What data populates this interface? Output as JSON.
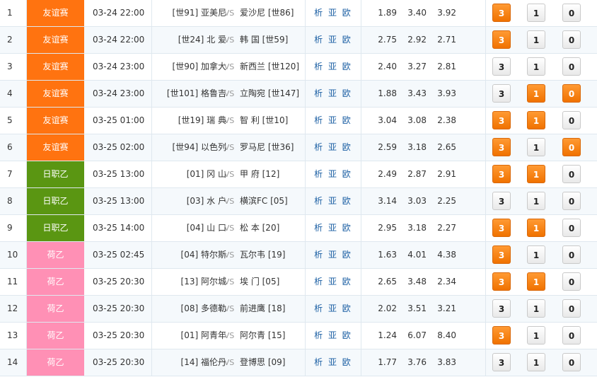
{
  "labels": {
    "vs": "VS",
    "analysis_links": "析 亚 欧"
  },
  "colors": {
    "friendly": "#ff7310",
    "j2": "#5a9612",
    "eredivisie2": "#ff90b5",
    "selected": "#f58215"
  },
  "matches": [
    {
      "num": "1",
      "league": "友谊赛",
      "league_type": "friendly",
      "time": "03-24 22:00",
      "home": "[世91] 亚美尼",
      "away": "爱沙尼 [世86]",
      "odds": [
        "1.89",
        "3.40",
        "3.92"
      ],
      "picks": [
        {
          "label": "3",
          "on": true
        },
        {
          "label": "1",
          "on": false
        },
        {
          "label": "0",
          "on": false
        }
      ]
    },
    {
      "num": "2",
      "league": "友谊赛",
      "league_type": "friendly",
      "time": "03-24 22:00",
      "home": "[世24] 北 爱",
      "away": "韩 国 [世59]",
      "odds": [
        "2.75",
        "2.92",
        "2.71"
      ],
      "picks": [
        {
          "label": "3",
          "on": true
        },
        {
          "label": "1",
          "on": false
        },
        {
          "label": "0",
          "on": false
        }
      ]
    },
    {
      "num": "3",
      "league": "友谊赛",
      "league_type": "friendly",
      "time": "03-24 23:00",
      "home": "[世90] 加拿大",
      "away": "新西兰 [世120]",
      "odds": [
        "2.40",
        "3.27",
        "2.81"
      ],
      "picks": [
        {
          "label": "3",
          "on": false
        },
        {
          "label": "1",
          "on": false
        },
        {
          "label": "0",
          "on": false
        }
      ]
    },
    {
      "num": "4",
      "league": "友谊赛",
      "league_type": "friendly",
      "time": "03-24 23:00",
      "home": "[世101] 格鲁吉",
      "away": "立陶宛 [世147]",
      "odds": [
        "1.88",
        "3.43",
        "3.93"
      ],
      "picks": [
        {
          "label": "3",
          "on": false
        },
        {
          "label": "1",
          "on": true
        },
        {
          "label": "0",
          "on": true
        }
      ]
    },
    {
      "num": "5",
      "league": "友谊赛",
      "league_type": "friendly",
      "time": "03-25 01:00",
      "home": "[世19] 瑞 典",
      "away": "智 利 [世10]",
      "odds": [
        "3.04",
        "3.08",
        "2.38"
      ],
      "picks": [
        {
          "label": "3",
          "on": true
        },
        {
          "label": "1",
          "on": true
        },
        {
          "label": "0",
          "on": false
        }
      ]
    },
    {
      "num": "6",
      "league": "友谊赛",
      "league_type": "friendly",
      "time": "03-25 02:00",
      "home": "[世94] 以色列",
      "away": "罗马尼 [世36]",
      "odds": [
        "2.59",
        "3.18",
        "2.65"
      ],
      "picks": [
        {
          "label": "3",
          "on": true
        },
        {
          "label": "1",
          "on": false
        },
        {
          "label": "0",
          "on": true
        }
      ]
    },
    {
      "num": "7",
      "league": "日职乙",
      "league_type": "j2",
      "time": "03-25 13:00",
      "home": "[01] 冈 山",
      "away": "甲 府 [12]",
      "odds": [
        "2.49",
        "2.87",
        "2.91"
      ],
      "picks": [
        {
          "label": "3",
          "on": true
        },
        {
          "label": "1",
          "on": true
        },
        {
          "label": "0",
          "on": false
        }
      ]
    },
    {
      "num": "8",
      "league": "日职乙",
      "league_type": "j2",
      "time": "03-25 13:00",
      "home": "[03] 水 户",
      "away": "横滨FC [05]",
      "odds": [
        "3.14",
        "3.03",
        "2.25"
      ],
      "picks": [
        {
          "label": "3",
          "on": false
        },
        {
          "label": "1",
          "on": false
        },
        {
          "label": "0",
          "on": false
        }
      ]
    },
    {
      "num": "9",
      "league": "日职乙",
      "league_type": "j2",
      "time": "03-25 14:00",
      "home": "[04] 山 口",
      "away": "松 本 [20]",
      "odds": [
        "2.95",
        "3.18",
        "2.27"
      ],
      "picks": [
        {
          "label": "3",
          "on": true
        },
        {
          "label": "1",
          "on": true
        },
        {
          "label": "0",
          "on": false
        }
      ]
    },
    {
      "num": "10",
      "league": "荷乙",
      "league_type": "eredivisie2",
      "time": "03-25 02:45",
      "home": "[04] 特尔斯",
      "away": "瓦尔韦 [19]",
      "odds": [
        "1.63",
        "4.01",
        "4.38"
      ],
      "picks": [
        {
          "label": "3",
          "on": true
        },
        {
          "label": "1",
          "on": false
        },
        {
          "label": "0",
          "on": false
        }
      ]
    },
    {
      "num": "11",
      "league": "荷乙",
      "league_type": "eredivisie2",
      "time": "03-25 20:30",
      "home": "[13] 阿尔城",
      "away": "埃 门 [05]",
      "odds": [
        "2.65",
        "3.48",
        "2.34"
      ],
      "picks": [
        {
          "label": "3",
          "on": true
        },
        {
          "label": "1",
          "on": true
        },
        {
          "label": "0",
          "on": false
        }
      ]
    },
    {
      "num": "12",
      "league": "荷乙",
      "league_type": "eredivisie2",
      "time": "03-25 20:30",
      "home": "[08] 多德勒",
      "away": "前进鹰 [18]",
      "odds": [
        "2.02",
        "3.51",
        "3.21"
      ],
      "picks": [
        {
          "label": "3",
          "on": false
        },
        {
          "label": "1",
          "on": false
        },
        {
          "label": "0",
          "on": false
        }
      ]
    },
    {
      "num": "13",
      "league": "荷乙",
      "league_type": "eredivisie2",
      "time": "03-25 20:30",
      "home": "[01] 阿青年",
      "away": "阿尔青 [15]",
      "odds": [
        "1.24",
        "6.07",
        "8.40"
      ],
      "picks": [
        {
          "label": "3",
          "on": true
        },
        {
          "label": "1",
          "on": false
        },
        {
          "label": "0",
          "on": false
        }
      ]
    },
    {
      "num": "14",
      "league": "荷乙",
      "league_type": "eredivisie2",
      "time": "03-25 20:30",
      "home": "[14] 福伦丹",
      "away": "登博思 [09]",
      "odds": [
        "1.77",
        "3.76",
        "3.83"
      ],
      "picks": [
        {
          "label": "3",
          "on": false
        },
        {
          "label": "1",
          "on": false
        },
        {
          "label": "0",
          "on": false
        }
      ]
    }
  ]
}
